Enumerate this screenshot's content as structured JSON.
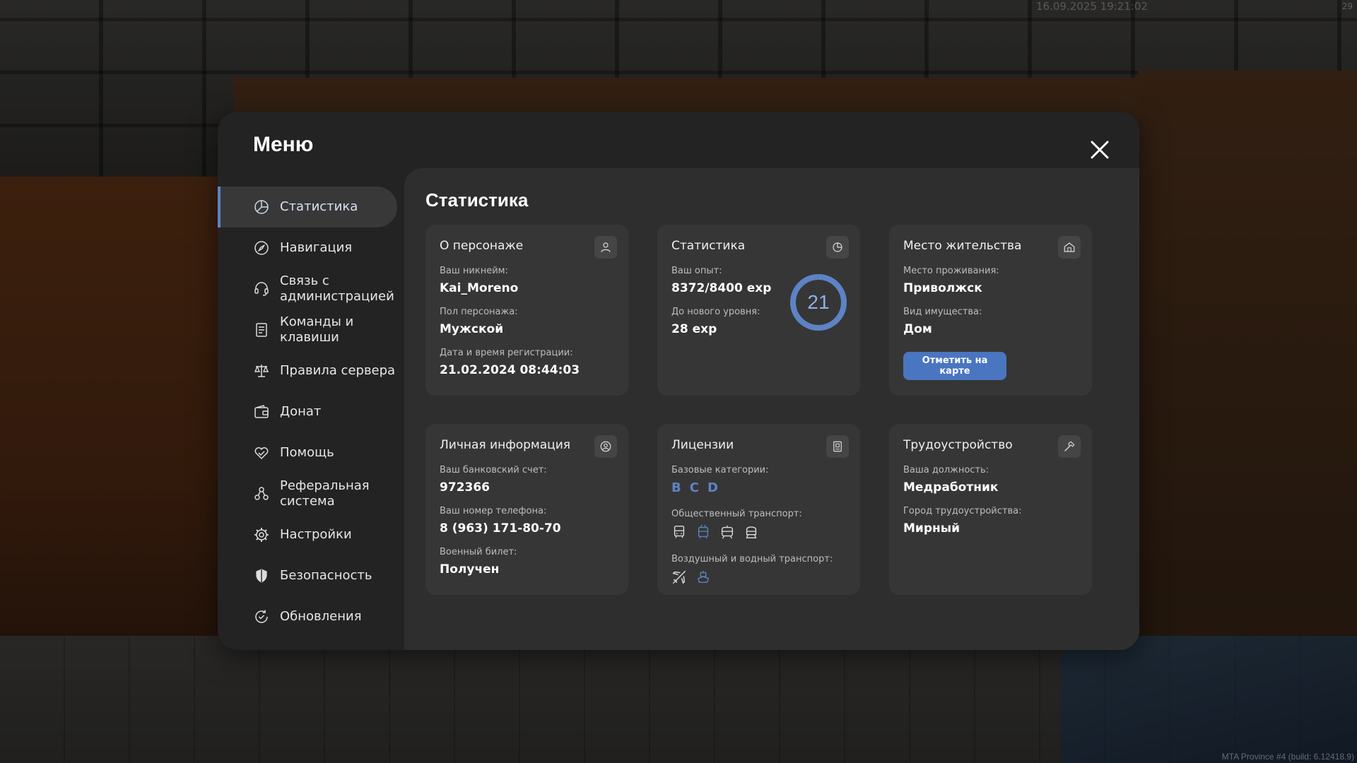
{
  "overlay": {
    "timestamp": "16.09.2025 19:21:02",
    "corner_text": "29",
    "build_info": "MTA Province #4 (build: 6.12418.9)"
  },
  "menu": {
    "title": "Меню",
    "close_icon": "close-icon",
    "accent_color": "#5d83c4"
  },
  "sidebar": {
    "items": [
      {
        "label": "Статистика",
        "icon": "pie-chart-icon",
        "active": true
      },
      {
        "label": "Навигация",
        "icon": "compass-icon"
      },
      {
        "label": "Связь с администрацией",
        "icon": "headset-icon"
      },
      {
        "label": "Команды и клавиши",
        "icon": "document-list-icon"
      },
      {
        "label": "Правила сервера",
        "icon": "scales-icon"
      },
      {
        "label": "Донат",
        "icon": "wallet-icon"
      },
      {
        "label": "Помощь",
        "icon": "handshake-heart-icon"
      },
      {
        "label": "Реферальная система",
        "icon": "referral-network-icon"
      },
      {
        "label": "Настройки",
        "icon": "gear-icon"
      },
      {
        "label": "Безопасность",
        "icon": "shield-icon"
      },
      {
        "label": "Обновления",
        "icon": "refresh-check-icon"
      }
    ]
  },
  "content": {
    "title": "Статистика",
    "cards": {
      "character": {
        "title": "О персонаже",
        "icon": "user-icon",
        "nickname_label": "Ваш никнейм:",
        "nickname": "Kai_Moreno",
        "gender_label": "Пол персонажа:",
        "gender": "Мужской",
        "reg_label": "Дата и время регистрации:",
        "reg_date": "21.02.2024 08:44:03"
      },
      "stats": {
        "title": "Статистика",
        "icon": "pie-chart-icon",
        "exp_label": "Ваш опыт:",
        "exp": "8372/8400 exp",
        "next_label": "До нового уровня:",
        "next": "28 exp",
        "level": "21",
        "exp_current": 8372,
        "exp_needed": 8400
      },
      "residence": {
        "title": "Место жительства",
        "icon": "house-icon",
        "place_label": "Место проживания:",
        "place": "Приволжск",
        "property_label": "Вид имущества:",
        "property": "Дом",
        "map_button": "Отметить на карте"
      },
      "personal": {
        "title": "Личная информация",
        "icon": "user-circle-icon",
        "bank_label": "Ваш банковский счет:",
        "bank": "972366",
        "phone_label": "Ваш номер телефона:",
        "phone": "8 (963) 171-80-70",
        "military_label": "Военный билет:",
        "military": "Получен"
      },
      "licenses": {
        "title": "Лицензии",
        "icon": "license-card-icon",
        "base_label": "Базовые категории:",
        "base": [
          "B",
          "C",
          "D"
        ],
        "public_label": "Общественный транспорт:",
        "air_label": "Воздушный и водный транспорт:"
      },
      "employment": {
        "title": "Трудоустройство",
        "icon": "hammer-icon",
        "position_label": "Ваша должность:",
        "position": "Медработник",
        "city_label": "Город трудоустройства:",
        "city": "Мирный"
      }
    }
  }
}
